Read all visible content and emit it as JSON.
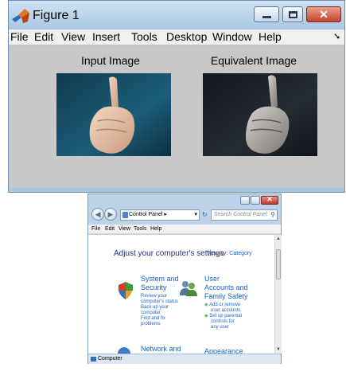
{
  "figure": {
    "title": "Figure 1",
    "menu": [
      "File",
      "Edit",
      "View",
      "Insert",
      "Tools",
      "Desktop",
      "Window",
      "Help"
    ],
    "left_image_title": "Input Image",
    "right_image_title": "Equivalent Image"
  },
  "control_panel": {
    "address": "Control Panel",
    "search_placeholder": "Search Control Panel",
    "menu": [
      "File",
      "Edit",
      "View",
      "Tools",
      "Help"
    ],
    "heading": "Adjust your computer's settings",
    "view_by_label": "View by:",
    "view_by_value": "Category",
    "categories": [
      {
        "title_lines": [
          "System and",
          "Security"
        ],
        "links": [
          "Review your",
          "computer's status",
          "Back up your",
          "computer",
          "Find and fix",
          "problems"
        ]
      },
      {
        "title_lines": [
          "User",
          "Accounts and",
          "Family Safety"
        ],
        "links": [
          "Add or remove",
          "user accounts",
          "Set up parental",
          "controls for",
          "any user"
        ]
      },
      {
        "title_lines": [
          "Network and"
        ],
        "links": []
      },
      {
        "title_lines": [
          "Appearance"
        ],
        "links": []
      }
    ],
    "status": "Computer"
  }
}
